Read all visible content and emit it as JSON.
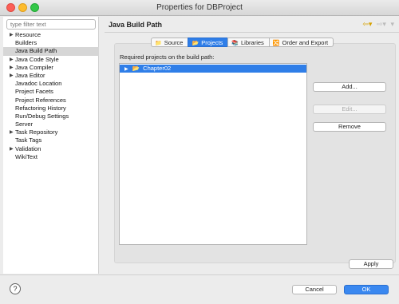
{
  "window": {
    "title": "Properties for DBProject"
  },
  "sidebar": {
    "filter_placeholder": "type filter text",
    "items": [
      {
        "label": "Resource",
        "has_children": true
      },
      {
        "label": "Builders",
        "has_children": false
      },
      {
        "label": "Java Build Path",
        "has_children": false,
        "selected": true
      },
      {
        "label": "Java Code Style",
        "has_children": true
      },
      {
        "label": "Java Compiler",
        "has_children": true
      },
      {
        "label": "Java Editor",
        "has_children": true
      },
      {
        "label": "Javadoc Location",
        "has_children": false
      },
      {
        "label": "Project Facets",
        "has_children": false
      },
      {
        "label": "Project References",
        "has_children": false
      },
      {
        "label": "Refactoring History",
        "has_children": false
      },
      {
        "label": "Run/Debug Settings",
        "has_children": false
      },
      {
        "label": "Server",
        "has_children": false
      },
      {
        "label": "Task Repository",
        "has_children": true
      },
      {
        "label": "Task Tags",
        "has_children": false
      },
      {
        "label": "Validation",
        "has_children": true
      },
      {
        "label": "WikiText",
        "has_children": false
      }
    ]
  },
  "page": {
    "title": "Java Build Path",
    "tabs": [
      {
        "label": "Source",
        "icon": "source-folder-icon"
      },
      {
        "label": "Projects",
        "icon": "projects-icon",
        "active": true
      },
      {
        "label": "Libraries",
        "icon": "libraries-icon"
      },
      {
        "label": "Order and Export",
        "icon": "order-export-icon"
      }
    ],
    "required_label": "Required projects on the build path:",
    "projects": [
      {
        "label": "Chapter02"
      }
    ],
    "buttons": {
      "add": "Add...",
      "edit": "Edit...",
      "remove": "Remove"
    },
    "apply": "Apply"
  },
  "footer": {
    "help": "?",
    "cancel": "Cancel",
    "ok": "OK"
  },
  "colors": {
    "accent": "#2f7ee8",
    "selection": "#d6d6d6"
  }
}
